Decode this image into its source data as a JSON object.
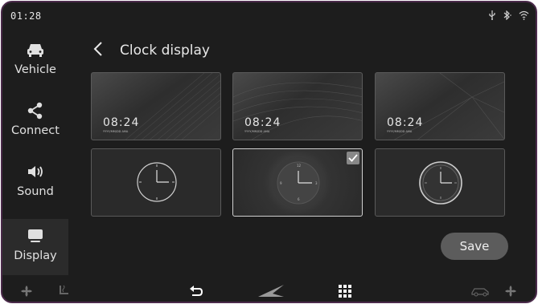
{
  "status": {
    "time": "01:28",
    "icons": [
      "usb-icon",
      "bluetooth-icon",
      "wifi-icon"
    ]
  },
  "sidebar": {
    "items": [
      {
        "label": "Vehicle",
        "icon": "car-icon",
        "active": false
      },
      {
        "label": "Connect",
        "icon": "share-icon",
        "active": false
      },
      {
        "label": "Sound",
        "icon": "speaker-icon",
        "active": false
      },
      {
        "label": "Display",
        "icon": "monitor-icon",
        "active": true
      }
    ]
  },
  "header": {
    "title": "Clock display"
  },
  "clock_styles": {
    "digital": [
      {
        "time": "08:24",
        "date_format": "YYYY/MM/DD AMA"
      },
      {
        "time": "08:24",
        "date_format": "YYYY/MM/DD AMA"
      },
      {
        "time": "08:24",
        "date_format": "YYYY/MM/DD AMA"
      }
    ],
    "analog": [
      {
        "selected": false
      },
      {
        "selected": true
      },
      {
        "selected": false
      }
    ]
  },
  "actions": {
    "save_label": "Save"
  },
  "bottom_bar": {
    "icons": [
      "fan-icon",
      "seat-heat-icon",
      "back-icon",
      "home-logo-icon",
      "apps-grid-icon",
      "car-outline-icon",
      "fan-icon"
    ]
  },
  "colors": {
    "background": "#1d1d1d",
    "accent_border": "#4a2a4a",
    "button": "#5c5c5c"
  }
}
